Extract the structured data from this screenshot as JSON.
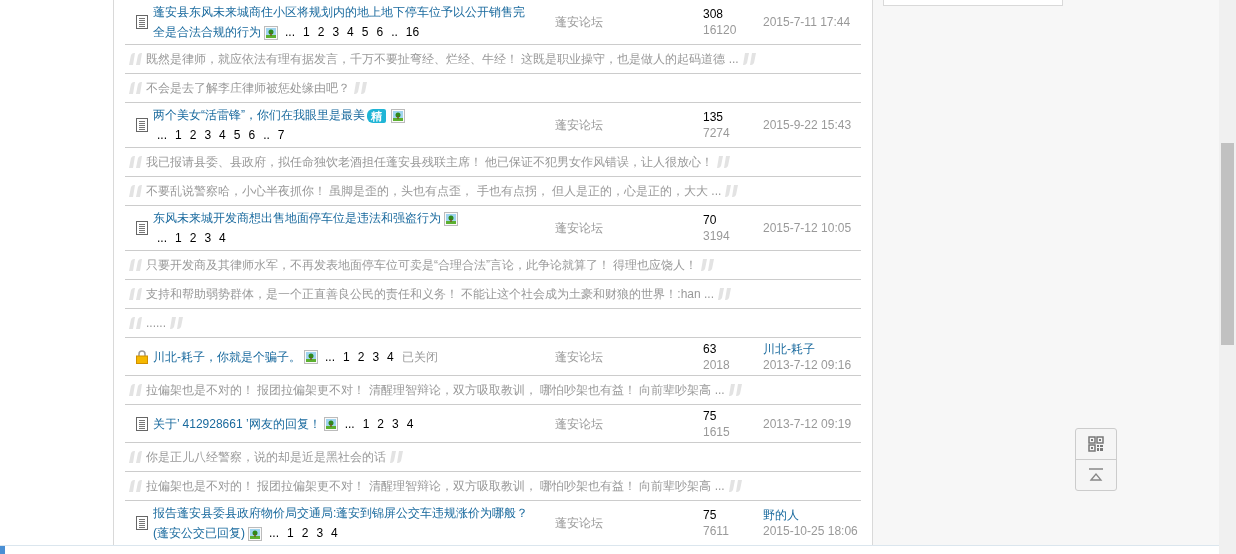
{
  "rows": [
    {
      "kind": "thread",
      "locked": false,
      "title_lines": [
        "蓬安县东风未来城商住小区将规划内的地上地下停车位予以公开销售完",
        "全是合法合规的行为"
      ],
      "tags": [
        {
          "kind": "image"
        }
      ],
      "pages": [
        "...",
        "1",
        "2",
        "3",
        "4",
        "5",
        "6",
        "..",
        "16"
      ],
      "pages_wrap": false,
      "forum": "蓬安论坛",
      "replies": "308",
      "views": "16120",
      "date": "2015-7-11 17:44"
    },
    {
      "kind": "quote",
      "text": "既然是律师，就应依法有理有据发言，千万不要扯弯经、烂经、牛经！ 这既是职业操守，也是做人的起码道德 ..."
    },
    {
      "kind": "quote",
      "text": "不会是去了解李庄律师被惩处缘由吧？"
    },
    {
      "kind": "thread",
      "locked": false,
      "title_lines": [
        "两个美女“活雷锋”，你们在我眼里是最美"
      ],
      "tags": [
        {
          "kind": "digest",
          "label": "精"
        },
        {
          "kind": "image"
        }
      ],
      "pages": [
        "...",
        "1",
        "2",
        "3",
        "4",
        "5",
        "6",
        "..",
        "7"
      ],
      "pages_wrap": true,
      "forum": "蓬安论坛",
      "replies": "135",
      "views": "7274",
      "date": "2015-9-22 15:43"
    },
    {
      "kind": "quote",
      "text": "我已报请县委、县政府，拟任命独饮老酒担任蓬安县残联主席！ 他已保证不犯男女作风错误，让人很放心！"
    },
    {
      "kind": "quote",
      "text": "不要乱说警察哈，小心半夜抓你！ 虽脚是歪的，头也有点歪， 手也有点拐， 但人是正的，心是正的，大大 ..."
    },
    {
      "kind": "thread",
      "locked": false,
      "title_lines": [
        "东风未来城开发商想出售地面停车位是违法和强盗行为"
      ],
      "tags": [
        {
          "kind": "image"
        }
      ],
      "pages": [
        "...",
        "1",
        "2",
        "3",
        "4"
      ],
      "pages_wrap": true,
      "forum": "蓬安论坛",
      "replies": "70",
      "views": "3194",
      "date": "2015-7-12 10:05"
    },
    {
      "kind": "quote",
      "text": "只要开发商及其律师水军，不再发表地面停车位可卖是“合理合法”言论，此争论就算了！ 得理也应饶人！"
    },
    {
      "kind": "quote",
      "text": "支持和帮助弱势群体，是一个正直善良公民的责任和义务！ 不能让这个社会成为土豪和财狼的世界！:han ..."
    },
    {
      "kind": "quote",
      "text": "......"
    },
    {
      "kind": "thread",
      "locked": true,
      "title_lines": [
        "川北-耗子，你就是个骗子。"
      ],
      "tags": [
        {
          "kind": "image"
        }
      ],
      "pages": [
        "...",
        "1",
        "2",
        "3",
        "4"
      ],
      "pages_wrap": false,
      "status": "已关闭",
      "forum": "蓬安论坛",
      "replies": "63",
      "views": "2018",
      "last_poster": "川北-耗子",
      "date": "2013-7-12 09:16"
    },
    {
      "kind": "quote",
      "text": "拉偏架也是不对的！ 报团拉偏架更不对！ 清醒理智辩论，双方吸取教训， 哪怕吵架也有益！ 向前辈吵架高 ..."
    },
    {
      "kind": "thread",
      "locked": false,
      "title_lines": [
        "关于’  412928661  ’网友的回复！"
      ],
      "tags": [
        {
          "kind": "image"
        }
      ],
      "pages": [
        "...",
        "1",
        "2",
        "3",
        "4"
      ],
      "pages_wrap": false,
      "forum": "蓬安论坛",
      "replies": "75",
      "views": "1615",
      "date": "2013-7-12 09:19"
    },
    {
      "kind": "quote",
      "text": "你是正儿八经警察，说的却是近是黑社会的话"
    },
    {
      "kind": "quote",
      "text": "拉偏架也是不对的！ 报团拉偏架更不对！ 清醒理智辩论，双方吸取教训， 哪怕吵架也有益！ 向前辈吵架高 ..."
    },
    {
      "kind": "thread",
      "locked": false,
      "title_lines": [
        "报告蓬安县委县政府物价局交通局:蓬安到锦屏公交车违规涨价为哪般？",
        "(蓬安公交已回复)"
      ],
      "tags": [
        {
          "kind": "image"
        }
      ],
      "pages": [
        "...",
        "1",
        "2",
        "3",
        "4"
      ],
      "pages_wrap": false,
      "forum": "蓬安论坛",
      "replies": "75",
      "views": "7611",
      "last_poster": "野的人",
      "date": "2015-10-25 18:06"
    }
  ]
}
